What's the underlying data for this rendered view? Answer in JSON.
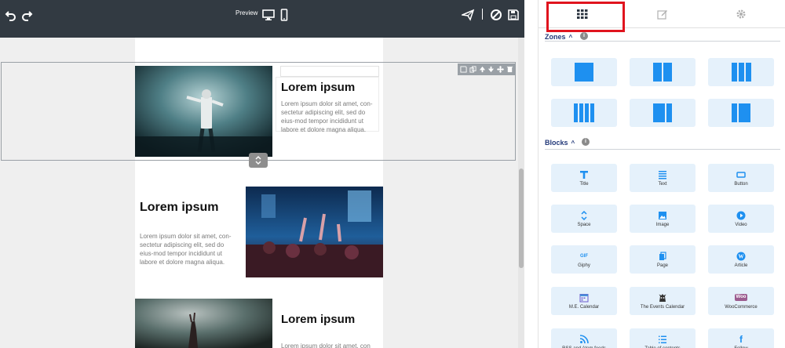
{
  "toolbar": {
    "preview_label": "Preview",
    "icons": [
      "undo-icon",
      "redo-icon",
      "desktop-icon",
      "mobile-icon",
      "send-icon",
      "cancel-icon",
      "save-icon"
    ]
  },
  "content": {
    "rows": [
      {
        "heading": "Lorem ipsum",
        "text": "Lorem ipsum dolor sit amet, con-sectetur adipiscing elit, sed do eius-mod tempor incididunt ut labore et dolore magna aliqua."
      },
      {
        "heading": "Lorem ipsum",
        "text": "Lorem ipsum dolor sit amet, con-sectetur adipiscing elit, sed do eius-mod tempor incididunt ut labore et dolore magna aliqua."
      },
      {
        "heading": "Lorem ipsum",
        "text": "Lorem ipsum dolor sit amet, con"
      }
    ]
  },
  "panel": {
    "tabs": [
      "grid-icon",
      "edit-icon",
      "gear-icon"
    ],
    "zones": {
      "title": "Zones",
      "chevron": "^",
      "info": "i"
    },
    "blocks": {
      "title": "Blocks",
      "chevron": "^",
      "info": "i",
      "items": [
        {
          "label": "Title",
          "icon": "title-icon"
        },
        {
          "label": "Text",
          "icon": "text-icon"
        },
        {
          "label": "Button",
          "icon": "button-icon"
        },
        {
          "label": "Space",
          "icon": "space-icon"
        },
        {
          "label": "Image",
          "icon": "image-icon"
        },
        {
          "label": "Video",
          "icon": "video-icon"
        },
        {
          "label": "Giphy",
          "icon": "giphy-icon",
          "glyph": "GIF"
        },
        {
          "label": "Page",
          "icon": "page-icon"
        },
        {
          "label": "Article",
          "icon": "wordpress-icon"
        },
        {
          "label": "M.E. Calendar",
          "icon": "calendar-icon"
        },
        {
          "label": "The Events Calendar",
          "icon": "events-calendar-icon"
        },
        {
          "label": "WooCommerce",
          "icon": "woocommerce-icon",
          "glyph": "Woo"
        },
        {
          "label": "RSS and Atom feeds",
          "icon": "rss-icon"
        },
        {
          "label": "Table of contents",
          "icon": "toc-icon"
        },
        {
          "label": "Follow",
          "icon": "facebook-icon",
          "glyph": "f"
        }
      ]
    }
  },
  "colors": {
    "toolbar_bg": "#323a42",
    "accent": "#1e90f0",
    "tile_bg": "#e5f1fb",
    "highlight": "#e0141e",
    "section_title": "#243a7a"
  }
}
